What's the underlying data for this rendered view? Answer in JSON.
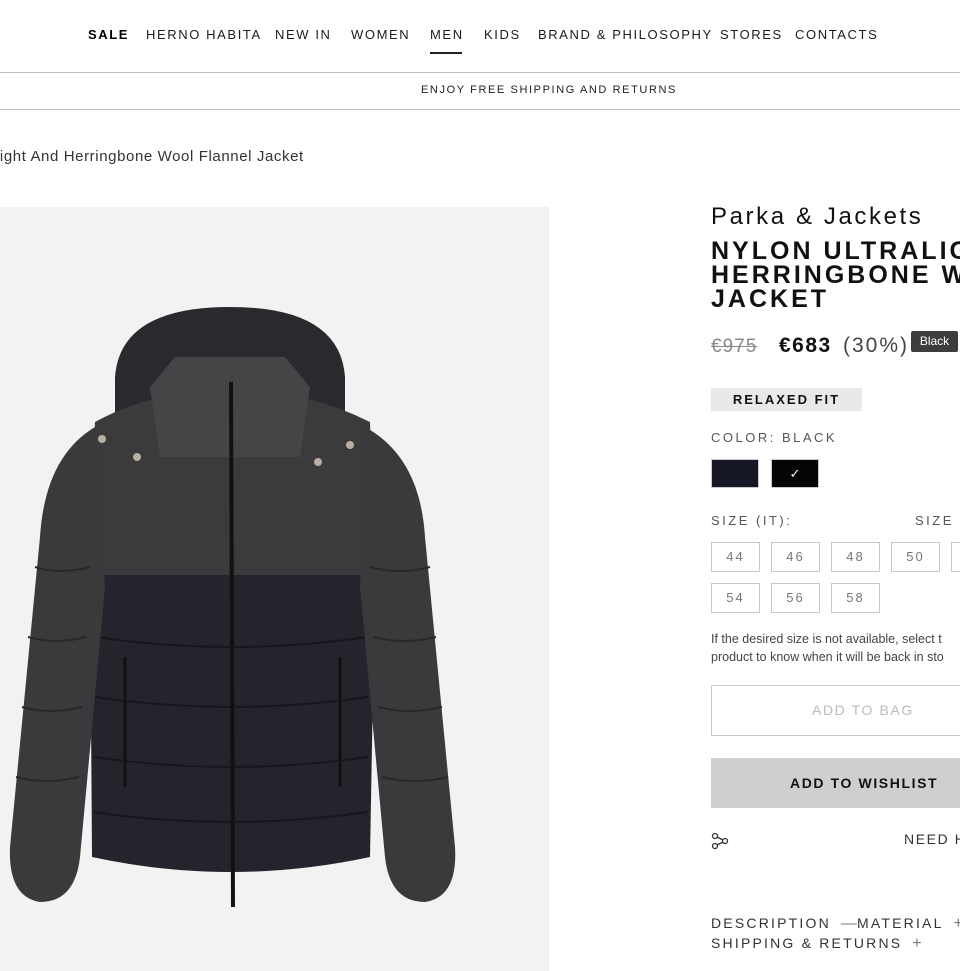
{
  "nav": {
    "items": [
      "SALE",
      "HERNO HABITA",
      "NEW IN",
      "WOMEN",
      "MEN",
      "KIDS",
      "BRAND & PHILOSOPHY",
      "STORES",
      "CONTACTS"
    ],
    "active": "MEN"
  },
  "promo_text": "ENJOY FREE SHIPPING AND RETURNS",
  "breadcrumb": "light And Herringbone Wool Flannel Jacket",
  "product": {
    "category": "Parka & Jackets",
    "title_lines": [
      "NYLON ULTRALIGH",
      "HERRINGBONE WO",
      "JACKET"
    ],
    "price_old": "€975",
    "price_new": "€683",
    "discount": "(30%)",
    "tooltip": "Black",
    "fit": "RELAXED FIT",
    "color_label": "COLOR: BLACK",
    "swatches": [
      {
        "name": "navy",
        "color": "#151725",
        "selected": false
      },
      {
        "name": "black",
        "color": "#050505",
        "selected": true
      }
    ],
    "size_label": "SIZE (IT):",
    "size_guide": "SIZE G",
    "sizes": [
      "44",
      "46",
      "48",
      "50",
      "",
      "54",
      "56",
      "58"
    ],
    "notice_lines": [
      "If the desired size is not available, select t",
      "product to know when it will be back in sto"
    ],
    "add_to_bag": "ADD TO BAG",
    "add_to_wishlist": "ADD TO WISHLIST",
    "share_icon": "share-icon",
    "need_help": "NEED H",
    "tabs": [
      {
        "label": "DESCRIPTION",
        "mark": "—"
      },
      {
        "label": "MATERIAL",
        "mark": "+"
      },
      {
        "label": "SHIPPING & RETURNS",
        "mark": "+"
      }
    ]
  }
}
